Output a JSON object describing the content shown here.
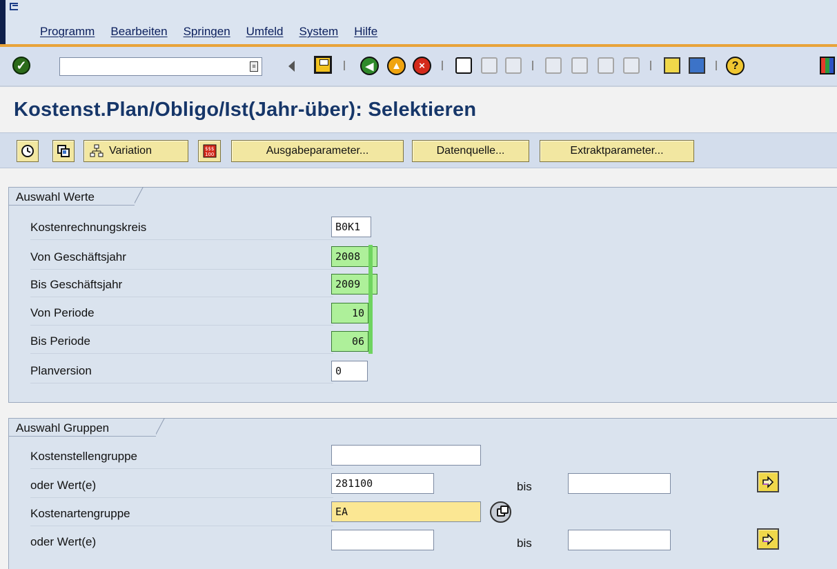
{
  "menu": {
    "items": [
      "Programm",
      "Bearbeiten",
      "Springen",
      "Umfeld",
      "System",
      "Hilfe"
    ]
  },
  "system_toolbar": {
    "command_field_value": "",
    "icons": [
      "ok-icon",
      "command-dropdown-icon",
      "back-arrow-icon",
      "save-icon",
      "back-icon",
      "exit-icon",
      "cancel-icon",
      "print-icon",
      "find-icon",
      "find-next-icon",
      "first-page-icon",
      "previous-page-icon",
      "next-page-icon",
      "last-page-icon",
      "new-session-icon",
      "shortcut-icon",
      "help-icon",
      "layout-menu-icon"
    ]
  },
  "page": {
    "title": "Kostenst.Plan/Obligo/Ist(Jahr-über): Selektieren"
  },
  "app_toolbar": {
    "variation_label": "Variation",
    "output_params_label": "Ausgabeparameter...",
    "data_source_label": "Datenquelle...",
    "extract_params_label": "Extraktparameter...",
    "icons": [
      "execute-icon",
      "get-variant-icon",
      "hierarchy-icon",
      "data-icon"
    ]
  },
  "values_group": {
    "title": "Auswahl Werte",
    "fields": [
      {
        "label": "Kostenrechnungskreis",
        "value": "B0K1"
      },
      {
        "label": "Von Geschäftsjahr",
        "value": "2008"
      },
      {
        "label": "Bis Geschäftsjahr",
        "value": "2009"
      },
      {
        "label": "Von Periode",
        "value": "10"
      },
      {
        "label": "Bis Periode",
        "value": "06"
      },
      {
        "label": "Planversion",
        "value": "0"
      }
    ]
  },
  "groups_group": {
    "title": "Auswahl Gruppen",
    "rows": [
      {
        "label": "Kostenstellengruppe",
        "value": ""
      },
      {
        "label": "oder Wert(e)",
        "value": "281100",
        "to_label": "bis",
        "to_value": ""
      },
      {
        "label": "Kostenartengruppe",
        "value": "EA"
      },
      {
        "label": "oder Wert(e)",
        "value": "",
        "to_label": "bis",
        "to_value": ""
      }
    ]
  }
}
